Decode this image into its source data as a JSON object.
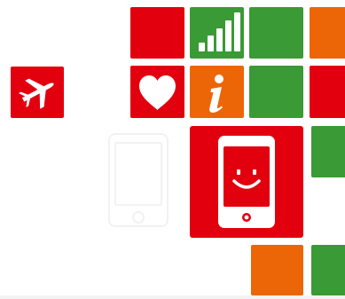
{
  "colors": {
    "red": "#e2000f",
    "green": "#3a9a35",
    "orange": "#ec6608",
    "white": "#ffffff",
    "ghost": "#f2f2f2"
  },
  "tiles": [
    {
      "name": "airplane-tile",
      "color": "red",
      "icon": "airplane-icon"
    },
    {
      "name": "plain-red-tile",
      "color": "red",
      "icon": ""
    },
    {
      "name": "signal-bars-tile",
      "color": "green",
      "icon": "signal-bars-icon"
    },
    {
      "name": "plain-green-tile",
      "color": "green",
      "icon": ""
    },
    {
      "name": "plain-orange-tile",
      "color": "orange",
      "icon": ""
    },
    {
      "name": "heart-tile",
      "color": "red",
      "icon": "heart-icon"
    },
    {
      "name": "info-tile",
      "color": "orange",
      "icon": "info-icon"
    },
    {
      "name": "plain-green-tile",
      "color": "green",
      "icon": ""
    },
    {
      "name": "plain-red-tile",
      "color": "red",
      "icon": ""
    },
    {
      "name": "smiling-phone-tile",
      "color": "red",
      "icon": "smiling-phone-icon"
    },
    {
      "name": "plain-green-tile",
      "color": "green",
      "icon": ""
    },
    {
      "name": "plain-orange-tile",
      "color": "orange",
      "icon": ""
    },
    {
      "name": "plain-green-tile",
      "color": "green",
      "icon": ""
    }
  ],
  "ghost_phone": {
    "icon": "phone-outline-icon"
  }
}
